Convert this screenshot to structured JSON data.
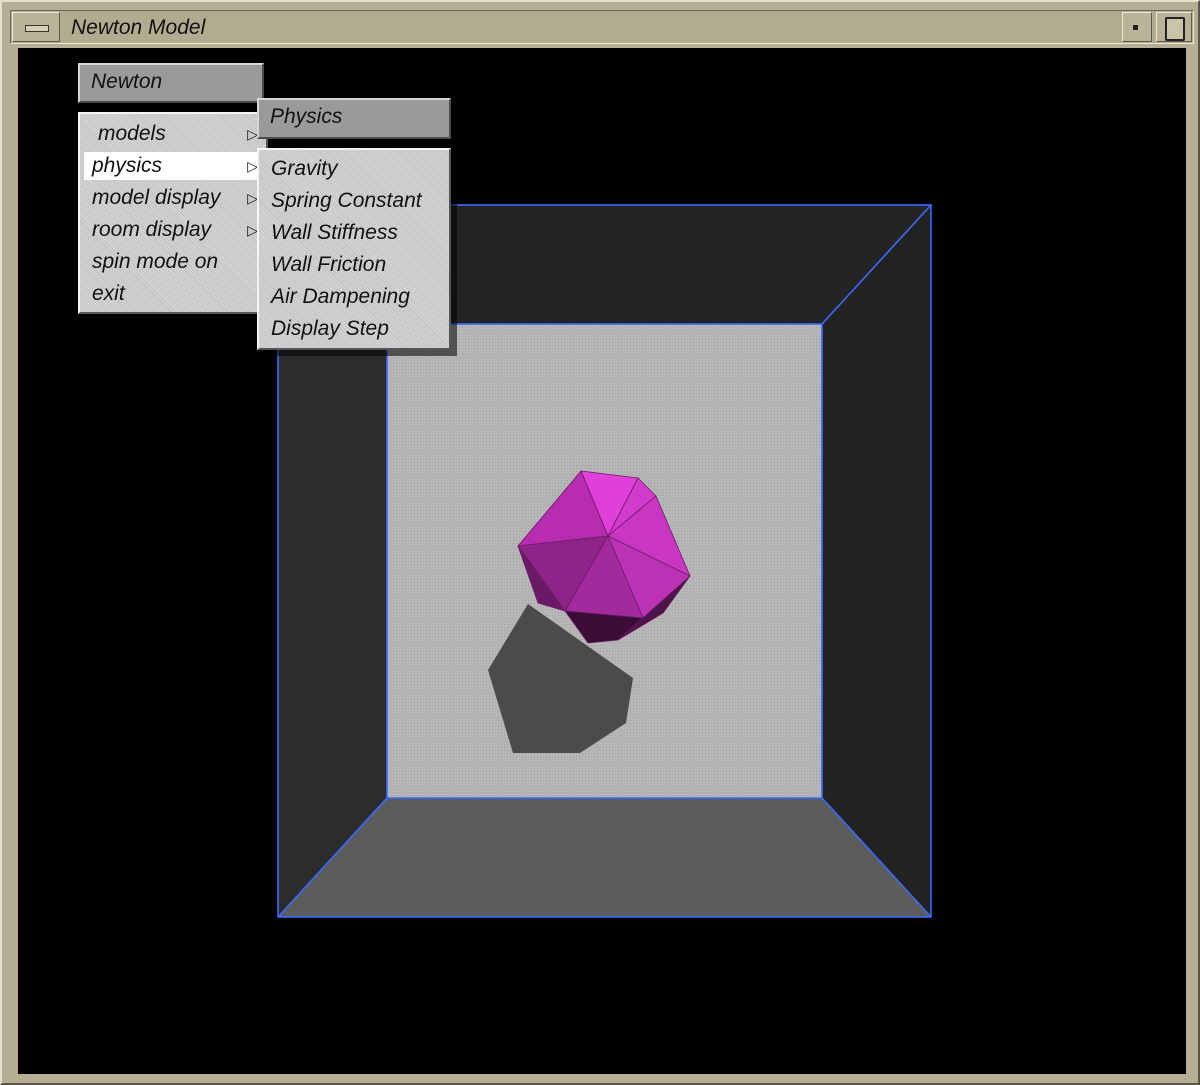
{
  "window": {
    "title": "Newton Model"
  },
  "colors": {
    "title_bar": "#b1ab90",
    "canvas_background": "#000000",
    "room_edge": "#3a6bff",
    "model_face": "#d030c8",
    "shadow": "#4b4b4b",
    "menu_highlight": "#ffffff"
  },
  "main_menu": {
    "title": "Newton",
    "items": [
      {
        "label": "models",
        "has_submenu": true
      },
      {
        "label": "physics",
        "has_submenu": true,
        "highlighted": true
      },
      {
        "label": "model display",
        "has_submenu": true
      },
      {
        "label": "room display",
        "has_submenu": true
      },
      {
        "label": "spin mode on",
        "has_submenu": false
      },
      {
        "label": "exit",
        "has_submenu": false
      }
    ]
  },
  "physics_menu": {
    "title": "Physics",
    "items": [
      {
        "label": "Gravity"
      },
      {
        "label": "Spring Constant"
      },
      {
        "label": "Wall Stiffness"
      },
      {
        "label": "Wall Friction"
      },
      {
        "label": "Air Dampening"
      },
      {
        "label": "Display Step"
      }
    ]
  },
  "icons": {
    "window_menu": "window-menu-bar-icon",
    "minimize": "minimize-dot-icon",
    "maximize": "maximize-square-icon",
    "submenu": "triangle-right-arrow-icon"
  }
}
